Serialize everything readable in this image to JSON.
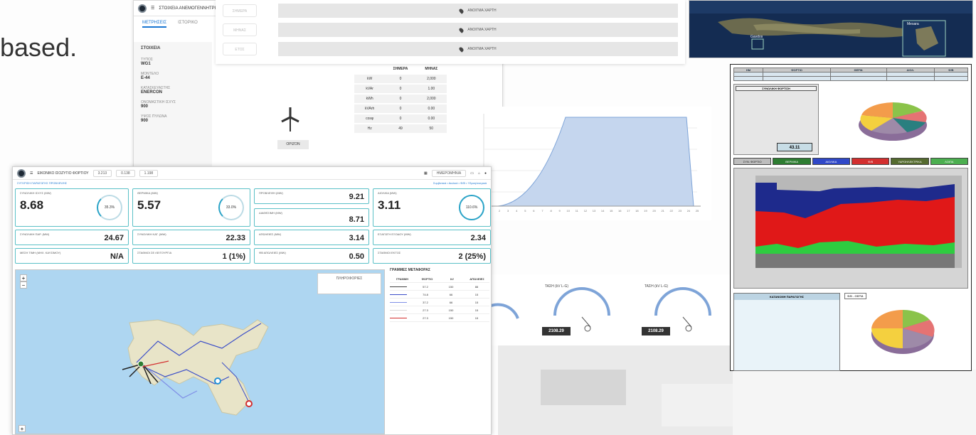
{
  "caption": "based.",
  "fleet_app": {
    "title": "ΣΤΟΙΧΕΙΑ ΑΝΕΜΟΓΕΝΝΗΤΡΙΑΣ",
    "tabs": [
      "ΜΕΤΡΗΣΕΙΣ",
      "ΙΣΤΟΡΙΚΟ"
    ],
    "section": "ΣΤΟΙΧΕΙΑ",
    "fields": [
      {
        "label": "ΤΥΠΟΣ",
        "value": "WG1"
      },
      {
        "label": "ΜΟΝΤΕΛΟ",
        "value": "E-44"
      },
      {
        "label": "ΚΑΤΑΣΚΕΥΑΣΤΗΣ",
        "value": "ENERCON"
      },
      {
        "label": "ΟΝΟΜΑΣΤΙΚΗ ΙΣΧΥΣ",
        "value": "900"
      },
      {
        "label": "ΥΨΟΣ ΠΥΛΩΝΑ",
        "value": "900"
      }
    ],
    "unit_button": "ΟΡΙΖΟΝ",
    "measure_headers": [
      "",
      "ΣΗΜΕΡΑ",
      "ΜΗΝΑΣ"
    ],
    "measure_rows": [
      [
        "kW",
        "0",
        "2,000"
      ],
      [
        "kVAr",
        "0",
        "1.00"
      ],
      [
        "kWh",
        "0",
        "2,000"
      ],
      [
        "kVArh",
        "0",
        "0.00"
      ],
      [
        "cosφ",
        "0",
        "0.00"
      ],
      [
        "Hz",
        "49",
        "50"
      ]
    ]
  },
  "top_rows": {
    "pills": [
      "ΣΗΜΕΡΑ",
      "ΜΗΝΑΣ",
      "ΕΤΟΣ"
    ],
    "bar_label": "ΑΝΟΙΓΜΑ ΧΑΡΤΗ"
  },
  "satellite": {
    "inset_label": "Gavdos",
    "inset2_label": "Mesara"
  },
  "curve": {
    "x_ticks": [
      "1",
      "2",
      "3",
      "4",
      "5",
      "6",
      "7",
      "8",
      "9",
      "10",
      "11",
      "12",
      "13",
      "14",
      "15",
      "16",
      "17",
      "18",
      "19",
      "20",
      "21",
      "22",
      "23",
      "24",
      "25"
    ]
  },
  "gauges": [
    {
      "title": "ΤΑΣΗ (kV L-G)",
      "value": "2108.29"
    },
    {
      "title": "ΤΑΣΗ (kV L-G)",
      "value": "2108.29"
    }
  ],
  "scada": {
    "heads": [
      "HM",
      "ΦΟΡΤΙΟ",
      "ΘΕΡΜ.",
      "ΑΙΟΛ.",
      "Φ/Β"
    ],
    "summary_title": "ΣΥΝΟΛΙΚΗ ΦΟΡΤΙΣΗ",
    "summary_value": "43.11",
    "legend": [
      {
        "label": "ΣΥΝ. ΦΟΡΤΙΟ",
        "color": "#bdbdbd"
      },
      {
        "label": "ΘΕΡΜΙΚΑ",
        "color": "#2e7d32"
      },
      {
        "label": "ΑΙΟΛΙΚΑ",
        "color": "#3048c8"
      },
      {
        "label": "Φ/Β",
        "color": "#d32f2f"
      },
      {
        "label": "ΥΔΡΟΗΛΕΚΤΡΙΚΑ",
        "color": "#556b2f"
      },
      {
        "label": "ΛΟΙΠΑ",
        "color": "#4caf50"
      }
    ],
    "bottom_title": "ΚΑΤΑΝΟΜΗ ΠΑΡΑΓΩΓΗΣ",
    "bottom_tab": "Φ/Β - ΘΕΡΜ."
  },
  "dashboard": {
    "topbar": {
      "app_name": "ΕΙΚΟΝΙΚΟ ΙΣΟΖΥΓΙΟ ΦΟΡΤΙΟΥ",
      "chips": [
        "3.213",
        "0.138",
        "1.198"
      ],
      "date_label": "ΗΜΕΡΟΜΗΝΙΑ"
    },
    "subbar_left": "ΣΥΓΚΡΙΣΗ ΠΑΡΑΓΩΓΗΣ ΠΡΟΒΛΕΨΗΣ",
    "subbar_right": "Συμβατικά • Αιολικά • Φ/Β • Υδροηλεκτρικά",
    "cards": {
      "c1": {
        "label": "ΣΥΝΟΛΙΚΗ ΙΣΧΥΣ (MW)",
        "value": "8.68",
        "ring": "35.3%"
      },
      "c2": {
        "label": "ΘΕΡΜΙΚΑ (MW)",
        "value": "5.57",
        "ring": "33.0%"
      },
      "c3": {
        "label": "ΑΙΟΛΙΚΑ (MW)",
        "value": "3.11",
        "ring": "110.6%"
      },
      "c4": {
        "label": "ΠΡΟΒΛΕΨΗ (MW)",
        "value": "9.21"
      },
      "c5": {
        "label": "ΔΙΑΘΕΣΙΜΗ (MW)",
        "value": "8.71"
      },
      "c6": {
        "label": "ΣΥΝΟΛΙΚΗ ΠΑΡ. (MW)",
        "value": "24.67"
      },
      "c7": {
        "label": "ΣΥΝΟΛΙΚΗ ΚΑΤ. (MW)",
        "value": "22.33"
      },
      "c8": {
        "label": "ΑΠΩΛΕΙΕΣ (MW)",
        "value": "3.14"
      },
      "c9": {
        "label": "ΕΞΑΓΩΓΗ ΕΞΟΔΟΥ (MW)",
        "value": "2.34"
      },
      "c10": {
        "label": "ΜΕΣΗ ΤΙΜΗ (ΜΗΧ. ΚΑΥΣΙΜΟΥ)",
        "value": "N/A"
      },
      "c11": {
        "label": "ΣΤΑΘΜΟΙ ΣΕ ΛΕΙΤΟΥΡΓΙΑ",
        "value": "1 (1%)"
      },
      "c12": {
        "label": "ΦΒ ΑΠΩΛΕΙΕΣ (MW)",
        "value": "0.50"
      },
      "c13": {
        "label": "ΣΤΑΘΜΟΙ ΕΚΤΟΣ",
        "value": "2 (25%)"
      }
    },
    "map_popup": "ΠΛΗΡΟΦΟΡΙΕΣ",
    "legend_title": "ΓΡΑΜΜΕΣ ΜΕΤΑΦΟΡΑΣ",
    "legend_headers": [
      "ΓΡΑΜΜΗ",
      "ΦΟΡΤΙΟ",
      "kV",
      "ΑΠΩΛΕΙΕΣ"
    ],
    "legend_rows": [
      {
        "color": "#444444",
        "v1": "57.2",
        "v2": "150",
        "v3": "88"
      },
      {
        "color": "#3b4ec8",
        "v1": "74.8",
        "v2": "66",
        "v3": "15"
      },
      {
        "color": "#7f8fe6",
        "v1": "37.2",
        "v2": "66",
        "v3": "15"
      },
      {
        "color": "#d8d8d8",
        "v1": "27.3",
        "v2": "150",
        "v3": "15"
      },
      {
        "color": "#d32f2f",
        "v1": "27.3",
        "v2": "150",
        "v3": "15"
      }
    ]
  }
}
